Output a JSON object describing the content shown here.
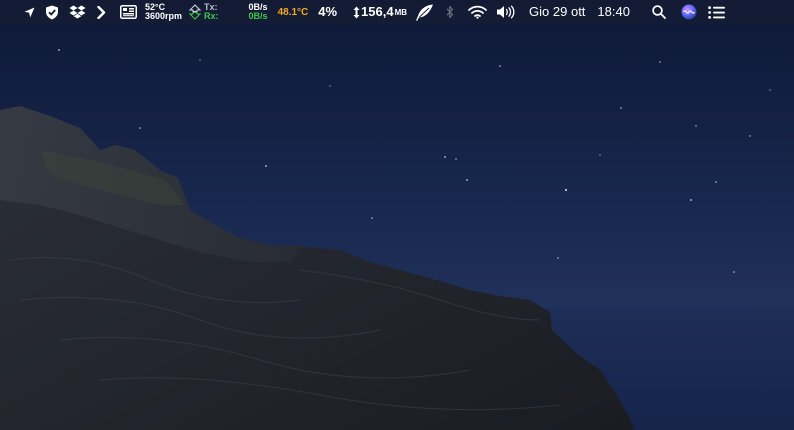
{
  "menubar": {
    "fan_temp": "52°C",
    "fan_rpm": "3600rpm",
    "net_tx_label": "Tx:",
    "net_rx_label": "Rx:",
    "net_tx_value": "0B/s",
    "net_rx_value": "0B/s",
    "cpu_temp": "48.1°C",
    "cpu_usage": "4%",
    "memory_value": "156,4",
    "memory_unit": "MB",
    "date": "Gio 29 ott",
    "time": "18:40"
  },
  "icons": {
    "location": "location-arrow-icon",
    "shield": "shield-check-icon",
    "dropbox": "dropbox-icon",
    "chevron": "chevron-right-icon",
    "hardware": "hardware-monitor-icon",
    "network": "network-arrows-icon",
    "memory": "up-down-arrow-icon",
    "feather": "feather-icon",
    "bluetooth": "bluetooth-icon",
    "wifi": "wifi-icon",
    "volume": "volume-icon",
    "search": "spotlight-search-icon",
    "siri": "siri-icon",
    "notification": "notification-center-icon"
  },
  "colors": {
    "menubar_bg": "#141c34",
    "orange_temp": "#f5a623",
    "green_net": "#3fc64a",
    "sky_top": "#0f1a3a",
    "sky_bottom": "#1d2d55"
  }
}
